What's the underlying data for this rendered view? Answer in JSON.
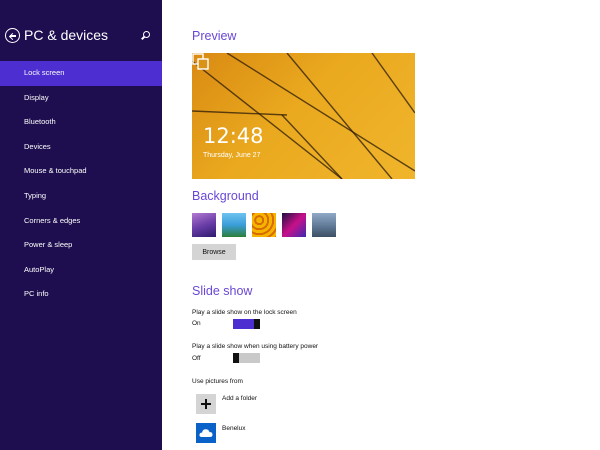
{
  "sidebar": {
    "title": "PC & devices",
    "back_icon": "back-arrow-icon",
    "search_icon": "search-icon",
    "bg_color": "#1e0e4f",
    "active_color": "#4d2fd1",
    "items": [
      {
        "label": "Lock screen",
        "active": true
      },
      {
        "label": "Display",
        "active": false
      },
      {
        "label": "Bluetooth",
        "active": false
      },
      {
        "label": "Devices",
        "active": false
      },
      {
        "label": "Mouse & touchpad",
        "active": false
      },
      {
        "label": "Typing",
        "active": false
      },
      {
        "label": "Corners & edges",
        "active": false
      },
      {
        "label": "Power & sleep",
        "active": false
      },
      {
        "label": "AutoPlay",
        "active": false
      },
      {
        "label": "PC info",
        "active": false
      }
    ]
  },
  "preview": {
    "heading": "Preview",
    "time": "12:48",
    "date": "Thursday, June 27",
    "icon": "slideshow-icon"
  },
  "background": {
    "heading": "Background",
    "browse_label": "Browse"
  },
  "slideshow": {
    "heading": "Slide show",
    "lock_screen": {
      "label": "Play a slide show on the lock screen",
      "state": "On",
      "on": true
    },
    "battery": {
      "label": "Play a slide show when using battery power",
      "state": "Off",
      "on": false
    },
    "use_pictures_label": "Use pictures from",
    "add_folder_label": "Add a folder",
    "add_icon": "plus-icon",
    "folders": [
      {
        "label": "Benelux",
        "icon": "onedrive-icon"
      }
    ]
  },
  "colors": {
    "heading": "#6a47d6",
    "accent": "#4d2fd1"
  }
}
